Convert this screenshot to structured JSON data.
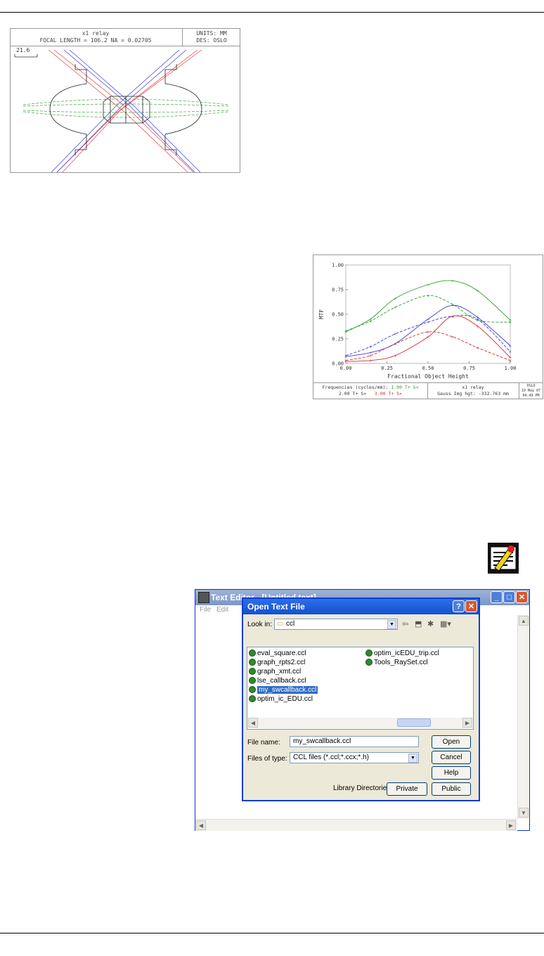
{
  "lens_drawing": {
    "title": "x1 relay",
    "subtitle": "FOCAL LENGTH = 106.2   NA = 0.02705",
    "units": "UNITS: MM",
    "designer": "DES: OSLO",
    "scale": "21.6"
  },
  "chart_data": {
    "type": "line",
    "title": "",
    "xlabel": "Fractional Object Height",
    "ylabel": "MTF",
    "xlim": [
      0,
      1
    ],
    "ylim": [
      0,
      1
    ],
    "x_ticks": [
      "0.00",
      "0.25",
      "0.50",
      "0.75",
      "1.00"
    ],
    "y_ticks": [
      "0.00",
      "0.25",
      "0.50",
      "0.75",
      "1.00"
    ],
    "grid": false,
    "series": [
      {
        "color": "#2a9e2a",
        "style": "solid",
        "x": [
          0,
          0.15,
          0.3,
          0.5,
          0.65,
          0.8,
          1.0
        ],
        "y": [
          0.32,
          0.45,
          0.66,
          0.8,
          0.84,
          0.74,
          0.44
        ]
      },
      {
        "color": "#2a9e2a",
        "style": "dashed",
        "x": [
          0,
          0.15,
          0.3,
          0.5,
          0.65,
          0.8,
          1.0
        ],
        "y": [
          0.33,
          0.43,
          0.57,
          0.69,
          0.6,
          0.44,
          0.42
        ]
      },
      {
        "color": "#3c3cd6",
        "style": "solid",
        "x": [
          0,
          0.15,
          0.3,
          0.5,
          0.65,
          0.8,
          1.0
        ],
        "y": [
          0.07,
          0.11,
          0.2,
          0.45,
          0.59,
          0.47,
          0.18
        ]
      },
      {
        "color": "#3c3cd6",
        "style": "dashed",
        "x": [
          0,
          0.15,
          0.3,
          0.5,
          0.65,
          0.8,
          1.0
        ],
        "y": [
          0.08,
          0.17,
          0.3,
          0.42,
          0.48,
          0.45,
          0.12
        ]
      },
      {
        "color": "#d62c2c",
        "style": "solid",
        "x": [
          0,
          0.15,
          0.3,
          0.5,
          0.65,
          0.8,
          1.0
        ],
        "y": [
          0.02,
          0.03,
          0.08,
          0.27,
          0.48,
          0.38,
          0.06
        ]
      },
      {
        "color": "#d62c2c",
        "style": "dashed",
        "x": [
          0,
          0.15,
          0.3,
          0.5,
          0.65,
          0.8,
          1.0
        ],
        "y": [
          0.03,
          0.08,
          0.2,
          0.32,
          0.27,
          0.16,
          0.03
        ]
      }
    ],
    "footer": {
      "freq_label": "Frequencies (cycles/mm):",
      "freq_1": "1.00 T+ S×",
      "freq_2": "2.00 T+ S×",
      "freq_3": "3.00 T+ S×",
      "lens_name": "x1 relay",
      "image_height": "Gauss Img hgt: -332.763 mm",
      "program": "OSLO",
      "date": "19 May 07",
      "time": "04:49 PM"
    }
  },
  "editor": {
    "title": "Text Editor - [Untitled text]",
    "menu": [
      "File",
      "Edit"
    ],
    "dialog": {
      "title": "Open Text File",
      "look_in_label": "Look in:",
      "look_in_value": "ccl",
      "files_col1": [
        "eval_square.ccl",
        "graph_rpts2.ccl",
        "graph_xmt.ccl",
        "lse_callback.ccl",
        "my_swcallback.ccl",
        "optim_ic_EDU.ccl"
      ],
      "files_col2": [
        "optim_icEDU_trip.ccl",
        "Tools_RaySet.ccl"
      ],
      "selected_file": "my_swcallback.ccl",
      "file_name_label": "File name:",
      "file_name_value": "my_swcallback.ccl",
      "file_type_label": "Files of type:",
      "file_type_value": "CCL files  (*.ccl;*.ccx;*.h)",
      "open_button": "Open",
      "cancel_button": "Cancel",
      "help_button": "Help",
      "library_label": "Library Directories:",
      "private_button": "Private",
      "public_button": "Public"
    }
  }
}
